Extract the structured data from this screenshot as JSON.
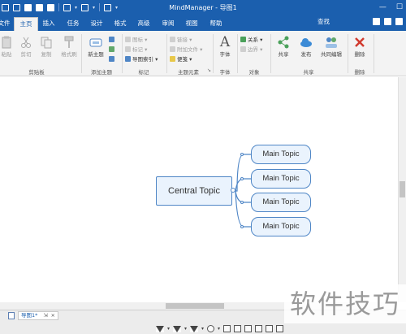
{
  "window": {
    "title": "MindManager - 导图1"
  },
  "tabs": [
    {
      "label": "文件",
      "active": false
    },
    {
      "label": "主页",
      "active": true
    },
    {
      "label": "插入",
      "active": false
    },
    {
      "label": "任务",
      "active": false
    },
    {
      "label": "设计",
      "active": false
    },
    {
      "label": "格式",
      "active": false
    },
    {
      "label": "高级",
      "active": false
    },
    {
      "label": "审阅",
      "active": false
    },
    {
      "label": "视图",
      "active": false
    },
    {
      "label": "帮助",
      "active": false
    }
  ],
  "search_label": "查找",
  "ribbon": {
    "clipboard": {
      "paste": "粘贴",
      "cut": "剪切",
      "copy": "复制",
      "format_painter": "格式刷",
      "group": "剪贴板"
    },
    "add_topic": {
      "new_topic": "新主题",
      "group": "添加主题"
    },
    "markers": {
      "icons": "图标",
      "tags": "标记",
      "map_index": "导图索引",
      "group": "标记"
    },
    "topic_elements": {
      "link": "链接",
      "attach_file": "附加文件",
      "notes": "便笺",
      "group": "主题元素"
    },
    "font": {
      "font": "字体",
      "group": "字体"
    },
    "objects": {
      "relationship": "关系",
      "boundary": "边界",
      "group": "对象"
    },
    "share": {
      "share": "共享",
      "publish": "发布",
      "co_edit": "共同编辑",
      "group": "共享"
    },
    "delete": {
      "delete": "删除",
      "group": "删除"
    }
  },
  "map": {
    "central_topic": "Central Topic",
    "main_topics": [
      "Main Topic",
      "Main Topic",
      "Main Topic",
      "Main Topic"
    ]
  },
  "status": {
    "doc_tab": "导图1*"
  },
  "watermark": "软件技巧",
  "colors": {
    "title_bar": "#1b5fae",
    "topic_border": "#4f86c6",
    "topic_fill": "#eaf3fd",
    "ribbon": "#f3f3f3"
  }
}
